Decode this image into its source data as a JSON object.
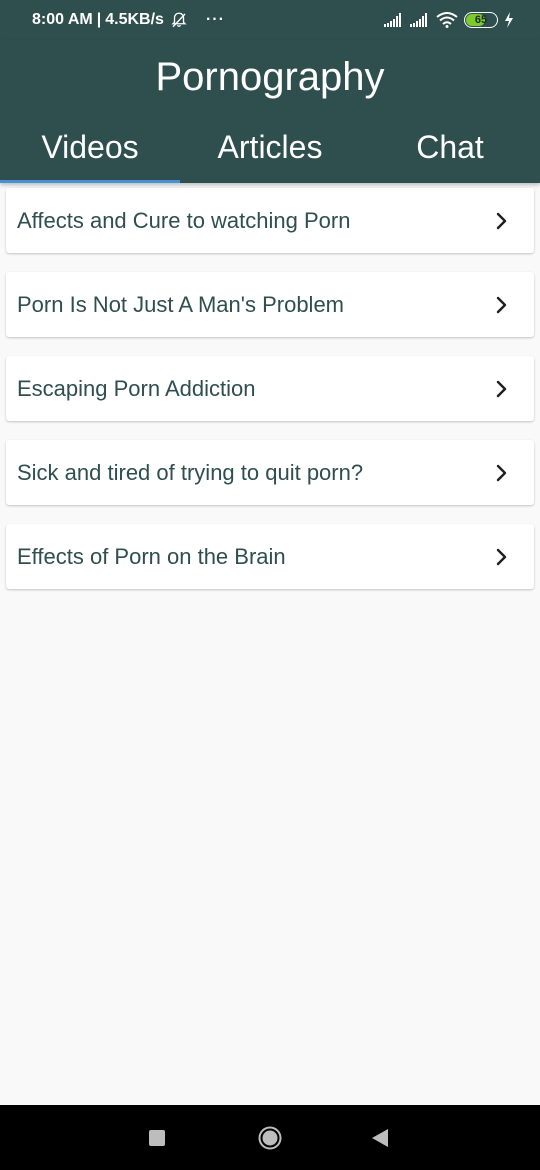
{
  "status_bar": {
    "time": "8:00 AM",
    "separator": "|",
    "speed": "4.5KB/s",
    "more": "···",
    "battery_level": "65",
    "battery_fraction": 0.65,
    "icons": [
      "bell-off-icon",
      "signal-icon",
      "signal-icon",
      "wifi-icon",
      "battery-icon",
      "charging-icon"
    ]
  },
  "header": {
    "title": "Pornography"
  },
  "tabs": [
    {
      "label": "Videos",
      "active": true
    },
    {
      "label": "Articles",
      "active": false
    },
    {
      "label": "Chat",
      "active": false
    }
  ],
  "list": {
    "items": [
      {
        "label": "Affects and Cure to watching Porn"
      },
      {
        "label": "Porn Is Not Just A Man's Problem"
      },
      {
        "label": "Escaping Porn Addiction"
      },
      {
        "label": "Sick and tired of trying to quit porn?"
      },
      {
        "label": "Effects of Porn on the Brain"
      }
    ]
  },
  "nav_bar": {
    "icons": [
      "recents-icon",
      "home-icon",
      "back-icon"
    ]
  },
  "colors": {
    "primary": "#2f4f4e",
    "tab_indicator": "#4a90d9",
    "background": "#f9f9f9",
    "battery_fill": "#7ec92b"
  }
}
